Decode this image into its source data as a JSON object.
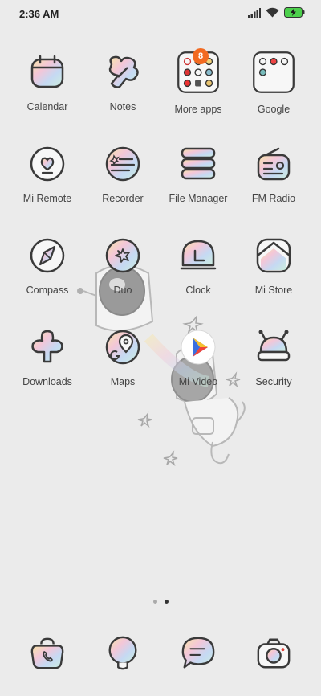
{
  "status_bar": {
    "time": "2:36 AM",
    "icons": [
      "signal-icon",
      "wifi-icon",
      "battery-charging-icon"
    ],
    "battery_color": "#4cd04c"
  },
  "apps": [
    {
      "label": "Calendar",
      "icon": "calendar-icon"
    },
    {
      "label": "Notes",
      "icon": "notes-icon"
    },
    {
      "label": "More apps",
      "icon": "folder-icon",
      "badge": "8"
    },
    {
      "label": "Google",
      "icon": "google-folder-icon"
    },
    {
      "label": "Mi Remote",
      "icon": "remote-icon"
    },
    {
      "label": "Recorder",
      "icon": "recorder-icon"
    },
    {
      "label": "File Manager",
      "icon": "file-manager-icon"
    },
    {
      "label": "FM Radio",
      "icon": "radio-icon"
    },
    {
      "label": "Compass",
      "icon": "compass-icon"
    },
    {
      "label": "Duo",
      "icon": "duo-icon"
    },
    {
      "label": "Clock",
      "icon": "clock-icon"
    },
    {
      "label": "Mi Store",
      "icon": "store-icon"
    },
    {
      "label": "Downloads",
      "icon": "downloads-icon"
    },
    {
      "label": "Maps",
      "icon": "maps-icon"
    },
    {
      "label": "Mi Video",
      "icon": "video-play-icon"
    },
    {
      "label": "Security",
      "icon": "security-icon"
    }
  ],
  "page_indicator": {
    "pages": 2,
    "current": 2
  },
  "dock": [
    {
      "icon": "phone-icon"
    },
    {
      "icon": "browser-icon"
    },
    {
      "icon": "messages-icon"
    },
    {
      "icon": "camera-icon"
    }
  ],
  "colors": {
    "background": "#ebebeb",
    "outline": "#3a3a3a",
    "badge": "#f26a21"
  }
}
